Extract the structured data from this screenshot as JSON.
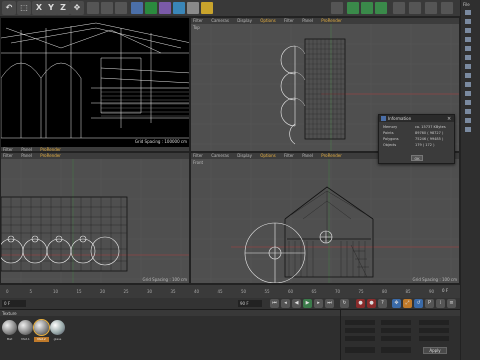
{
  "toolbar": {
    "x": "X",
    "y": "Y",
    "z": "Z"
  },
  "viewports": {
    "menu": [
      "Filter",
      "Cameras",
      "Display",
      "Options",
      "Filter",
      "Panel",
      "ProRender"
    ],
    "menu_short": [
      "Filter",
      "Panel",
      "ProRender"
    ],
    "perspective": {
      "grid": "Grid Spacing : 100000 cm"
    },
    "top": {
      "label": "Top"
    },
    "right": {
      "grid": "Grid Spacing : 100 cm"
    },
    "front": {
      "label": "Front",
      "grid": "Grid Spacing : 100 cm"
    }
  },
  "dialog": {
    "title": "Information",
    "rows": [
      {
        "key": "Memory",
        "value": "ca. 15737 KBytes"
      },
      {
        "key": "Points",
        "value": "89760 ( 98727 )"
      },
      {
        "key": "Polygons",
        "value": "75246 ( 99485 )"
      },
      {
        "key": "Objects",
        "value": "179 ( 172 )"
      }
    ],
    "ok": "OK"
  },
  "timeline": {
    "ticks": [
      "0",
      "5",
      "10",
      "15",
      "20",
      "25",
      "30",
      "35",
      "40",
      "45",
      "50",
      "55",
      "60",
      "65",
      "70",
      "75",
      "80",
      "85",
      "90"
    ],
    "frame": "0 F"
  },
  "transport": {
    "start": "0 F",
    "end": "90 F"
  },
  "materials": {
    "label": "Texture",
    "items": [
      "Mat",
      "Mat.1",
      "Mat.2",
      "glass"
    ]
  },
  "attributes": {
    "apply": "Apply"
  },
  "right_panel": {
    "label": "File"
  },
  "colors": {
    "accent": "#e8b040",
    "axis_x": "#c03030",
    "axis_y": "#30a030"
  }
}
